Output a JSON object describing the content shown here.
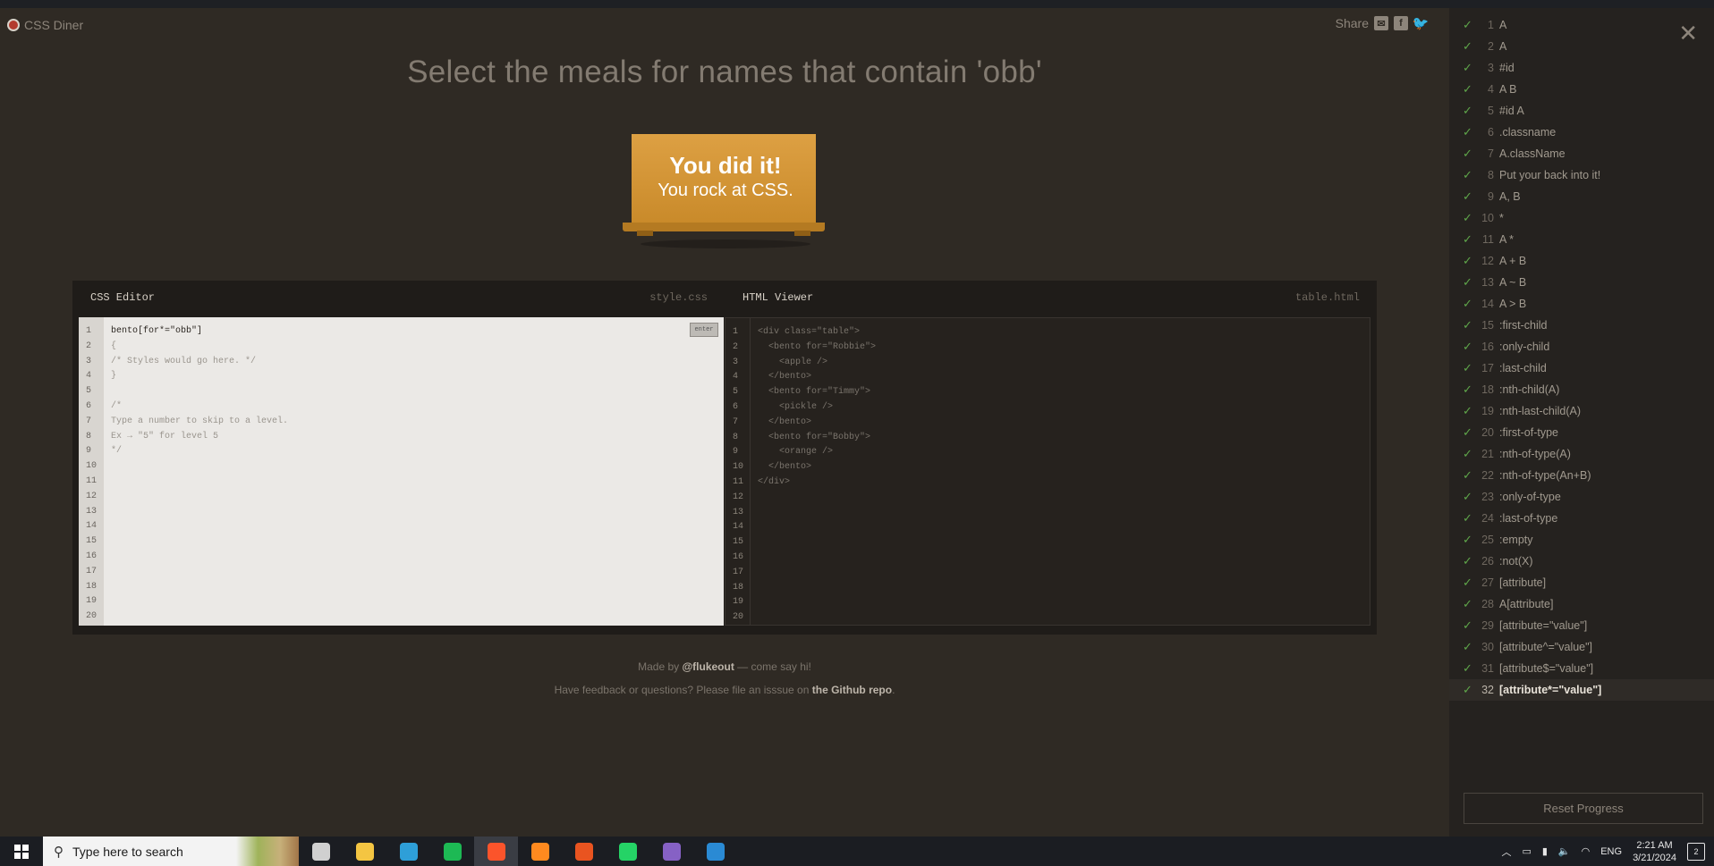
{
  "app": {
    "title": "CSS Diner"
  },
  "share": {
    "label": "Share",
    "icons": [
      "mail-icon",
      "facebook-icon",
      "twitter-icon"
    ]
  },
  "order": "Select the meals for names that contain 'obb'",
  "table_message": {
    "line1": "You did it!",
    "line2": "You rock at CSS."
  },
  "css_editor": {
    "title": "CSS Editor",
    "filename": "style.css",
    "enter_label": "enter",
    "lines": [
      "bento[for*=\"obb\"]",
      "{",
      "/* Styles would go here. */",
      "}",
      "",
      "/*",
      "Type a number to skip to a level.",
      "Ex → \"5\" for level 5",
      "*/",
      "",
      "",
      "",
      "",
      "",
      "",
      "",
      "",
      "",
      "",
      ""
    ]
  },
  "html_viewer": {
    "title": "HTML Viewer",
    "filename": "table.html",
    "lines": [
      "<div class=\"table\">",
      "  <bento for=\"Robbie\">",
      "    <apple />",
      "  </bento>",
      "  <bento for=\"Timmy\">",
      "    <pickle />",
      "  </bento>",
      "  <bento for=\"Bobby\">",
      "    <orange />",
      "  </bento>",
      "</div>",
      "",
      "",
      "",
      "",
      "",
      "",
      "",
      "",
      ""
    ]
  },
  "footer": {
    "line1_pre": "Made by ",
    "line1_link": "@flukeout",
    "line1_post": " — come say hi!",
    "line2_pre": "Have feedback or questions? Please file an isssue on ",
    "line2_link": "the Github repo",
    "line2_post": "."
  },
  "levels": [
    {
      "num": "1",
      "name": "A"
    },
    {
      "num": "2",
      "name": "A"
    },
    {
      "num": "3",
      "name": "#id"
    },
    {
      "num": "4",
      "name": "A B"
    },
    {
      "num": "5",
      "name": "#id A"
    },
    {
      "num": "6",
      "name": ".classname"
    },
    {
      "num": "7",
      "name": "A.className"
    },
    {
      "num": "8",
      "name": "Put your back into it!"
    },
    {
      "num": "9",
      "name": "A, B"
    },
    {
      "num": "10",
      "name": "*"
    },
    {
      "num": "11",
      "name": "A *"
    },
    {
      "num": "12",
      "name": "A + B"
    },
    {
      "num": "13",
      "name": "A ~ B"
    },
    {
      "num": "14",
      "name": "A > B"
    },
    {
      "num": "15",
      "name": ":first-child"
    },
    {
      "num": "16",
      "name": ":only-child"
    },
    {
      "num": "17",
      "name": ":last-child"
    },
    {
      "num": "18",
      "name": ":nth-child(A)"
    },
    {
      "num": "19",
      "name": ":nth-last-child(A)"
    },
    {
      "num": "20",
      "name": ":first-of-type"
    },
    {
      "num": "21",
      "name": ":nth-of-type(A)"
    },
    {
      "num": "22",
      "name": ":nth-of-type(An+B)"
    },
    {
      "num": "23",
      "name": ":only-of-type"
    },
    {
      "num": "24",
      "name": ":last-of-type"
    },
    {
      "num": "25",
      "name": ":empty"
    },
    {
      "num": "26",
      "name": ":not(X)"
    },
    {
      "num": "27",
      "name": "[attribute]"
    },
    {
      "num": "28",
      "name": "A[attribute]"
    },
    {
      "num": "29",
      "name": "[attribute=\"value\"]"
    },
    {
      "num": "30",
      "name": "[attribute^=\"value\"]"
    },
    {
      "num": "31",
      "name": "[attribute$=\"value\"]"
    },
    {
      "num": "32",
      "name": "[attribute*=\"value\"]"
    }
  ],
  "active_level": "32",
  "reset_label": "Reset Progress",
  "taskbar": {
    "search_placeholder": "Type here to search",
    "language": "ENG",
    "time": "2:21 AM",
    "date": "3/21/2024",
    "notification_count": "2",
    "apps": [
      {
        "name": "task-view-icon",
        "color": "#d0d0d0"
      },
      {
        "name": "file-explorer-icon",
        "color": "#f4c542"
      },
      {
        "name": "edge-icon",
        "color": "#2e9fd8"
      },
      {
        "name": "spotify-icon",
        "color": "#1db954"
      },
      {
        "name": "brave-icon",
        "color": "#fb542b"
      },
      {
        "name": "firefox-icon",
        "color": "#ff8a1f"
      },
      {
        "name": "ubuntu-icon",
        "color": "#e95420"
      },
      {
        "name": "whatsapp-icon",
        "color": "#25d366"
      },
      {
        "name": "visual-studio-icon",
        "color": "#8661c5"
      },
      {
        "name": "vscode-icon",
        "color": "#2a8ad4"
      }
    ]
  }
}
